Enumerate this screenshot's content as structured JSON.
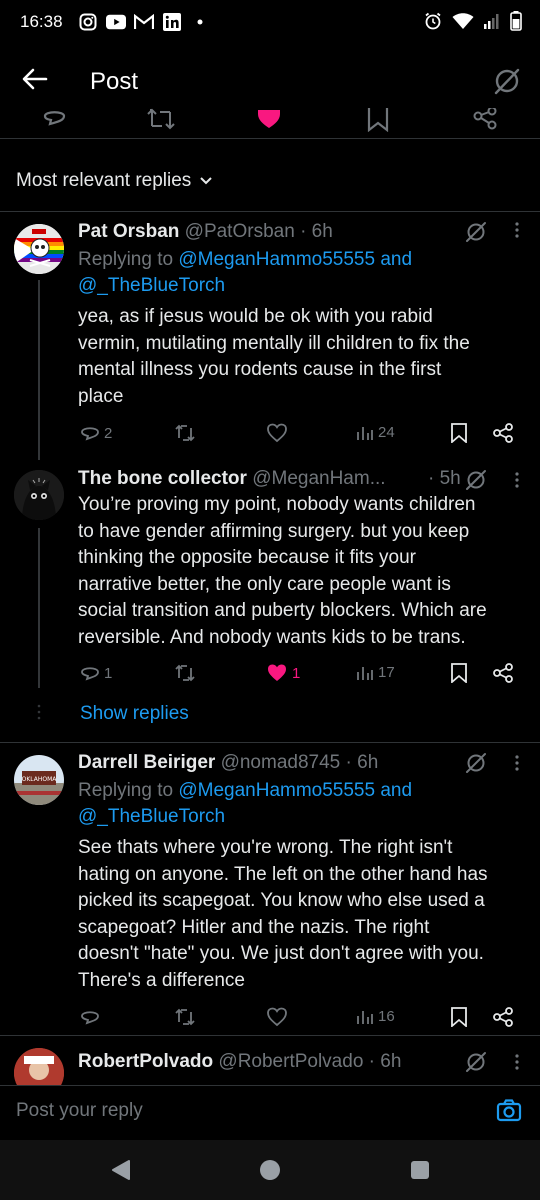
{
  "status_bar": {
    "time": "16:38",
    "left_icons": [
      "instagram-icon",
      "youtube-icon",
      "gmail-icon",
      "linkedin-icon",
      "dot-icon"
    ],
    "right_icons": [
      "alarm-icon",
      "wifi-icon",
      "signal-icon",
      "battery-icon"
    ]
  },
  "header": {
    "title": "Post",
    "back_icon": "arrow-left-icon",
    "grok_icon": "grok-icon"
  },
  "top_actions": [
    "reply-icon",
    "retweet-icon",
    "like-icon",
    "bookmark-icon",
    "share-icon"
  ],
  "sort": {
    "label": "Most relevant replies"
  },
  "tweets": [
    {
      "name": "Pat Orsban",
      "handle": "@PatOrsban",
      "time": "· 6h",
      "replying_prefix": "Replying to ",
      "replying_to": "@MeganHammo55555 and",
      "replying_to_2": "@_TheBlueTorch",
      "lines": [
        "yea, as if jesus would be ok with you rabid",
        "vermin, mutilating mentally ill children to fix the",
        "mental illness you rodents cause in the first",
        "place"
      ],
      "replies": "2",
      "retweets": "",
      "likes": "",
      "views": "24"
    },
    {
      "name": "The bone collector",
      "handle": "@MeganHam...",
      "time": "· 5h",
      "lines": [
        "You’re proving my point, nobody wants children",
        "to have gender affirming surgery. but you keep",
        "thinking the opposite because it fits your",
        "narrative better, the only care people want is",
        "social transition and puberty blockers. Which are",
        "reversible. And nobody wants kids to be trans."
      ],
      "replies": "1",
      "retweets": "",
      "likes": "1",
      "views": "17",
      "show_replies": "Show replies"
    },
    {
      "name": "Darrell Beiriger",
      "handle": "@nomad8745",
      "time": "· 6h",
      "avatar_text": "OKLAHOMA",
      "replying_prefix": "Replying to ",
      "replying_to": "@MeganHammo55555 and",
      "replying_to_2": "@_TheBlueTorch",
      "lines": [
        "See thats where you're wrong. The right isn't",
        "hating on anyone. The left on the other hand has",
        "picked its scapegoat. You know who else used a",
        "scapegoat? Hitler and the nazis. The right",
        "doesn't \"hate\" you. We just don't agree with you.",
        "There's a difference"
      ],
      "replies": "",
      "retweets": "",
      "likes": "",
      "views": "16"
    },
    {
      "name": "RobertPolvado",
      "handle": "@RobertPolvado",
      "time": "· 6h"
    }
  ],
  "reply_bar": {
    "placeholder": "Post your reply",
    "camera_icon": "camera-icon"
  },
  "nav": [
    "back-triangle-icon",
    "home-circle-icon",
    "recents-square-icon"
  ],
  "colors": {
    "background": "#000000",
    "accent": "#1d9bf0",
    "like": "#f91880",
    "secondary_text": "#71767b",
    "primary_text": "#e7e9ea"
  }
}
